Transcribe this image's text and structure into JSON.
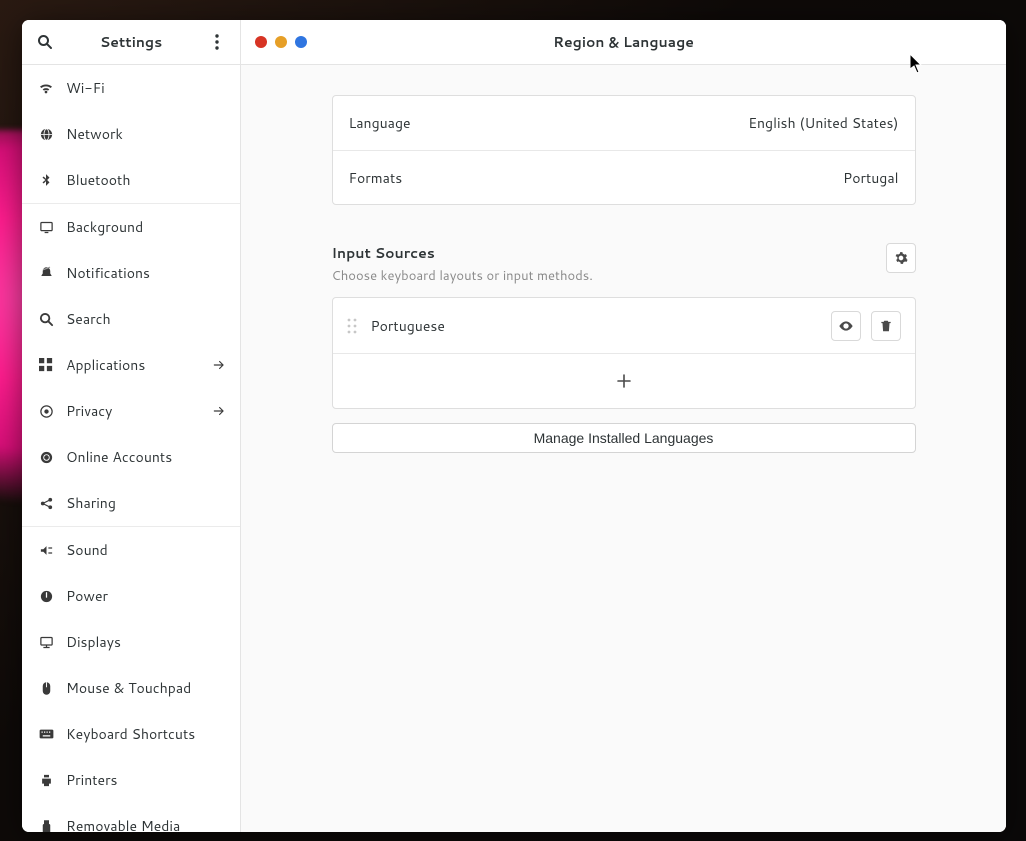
{
  "sidebar": {
    "title": "Settings",
    "items": [
      {
        "label": "Wi-Fi",
        "icon": "wifi-icon",
        "group_start": false
      },
      {
        "label": "Network",
        "icon": "globe-icon"
      },
      {
        "label": "Bluetooth",
        "icon": "bluetooth-icon"
      },
      {
        "label": "Background",
        "icon": "display-icon",
        "group_start": true
      },
      {
        "label": "Notifications",
        "icon": "bell-icon"
      },
      {
        "label": "Search",
        "icon": "search-icon"
      },
      {
        "label": "Applications",
        "icon": "apps-icon",
        "chevron": true
      },
      {
        "label": "Privacy",
        "icon": "target-icon",
        "chevron": true
      },
      {
        "label": "Online Accounts",
        "icon": "cloud-icon"
      },
      {
        "label": "Sharing",
        "icon": "share-icon"
      },
      {
        "label": "Sound",
        "icon": "sound-icon",
        "group_start": true
      },
      {
        "label": "Power",
        "icon": "power-icon"
      },
      {
        "label": "Displays",
        "icon": "monitor-icon"
      },
      {
        "label": "Mouse & Touchpad",
        "icon": "mouse-icon"
      },
      {
        "label": "Keyboard Shortcuts",
        "icon": "keyboard-icon"
      },
      {
        "label": "Printers",
        "icon": "printer-icon"
      },
      {
        "label": "Removable Media",
        "icon": "usb-icon"
      }
    ]
  },
  "header": {
    "title": "Region & Language"
  },
  "region": {
    "language_label": "Language",
    "language_value": "English (United States)",
    "formats_label": "Formats",
    "formats_value": "Portugal"
  },
  "input_sources": {
    "title": "Input Sources",
    "subtitle": "Choose keyboard layouts or input methods.",
    "items": [
      {
        "name": "Portuguese"
      }
    ],
    "manage_button": "Manage Installed Languages"
  }
}
